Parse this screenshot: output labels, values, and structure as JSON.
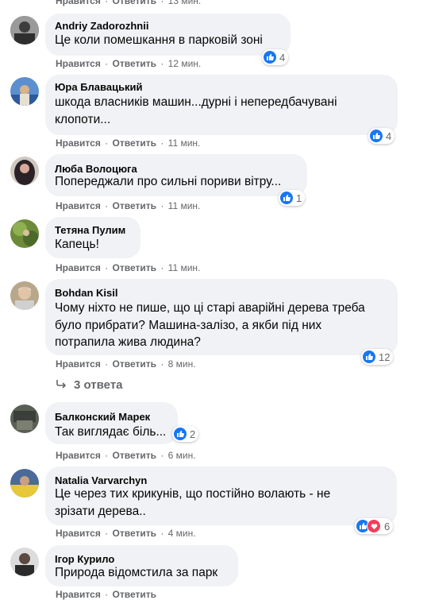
{
  "top_cut": {
    "like": "Нравится",
    "reply": "Ответить",
    "time": "13 мин."
  },
  "comments": [
    {
      "author": "Andriy Zadorozhnii",
      "lines": [
        "Це коли помешкання в парковій зоні"
      ],
      "like": "Нравится",
      "reply": "Ответить",
      "time": "12 мин.",
      "reactions": "4"
    },
    {
      "author": "Юра Блавацький",
      "lines": [
        "шкода власників машин...дурні і непередбачувані",
        "клопоти..."
      ],
      "like": "Нравится",
      "reply": "Ответить",
      "time": "11 мин.",
      "reactions": "4"
    },
    {
      "author": "Люба Волоцюга",
      "lines": [
        "Попереджали про сильні пориви вітру..."
      ],
      "like": "Нравится",
      "reply": "Ответить",
      "time": "11 мин.",
      "reactions": "1"
    },
    {
      "author": "Тетяна Пулим",
      "lines": [
        "Капець!"
      ],
      "like": "Нравится",
      "reply": "Ответить",
      "time": "11 мин.",
      "reactions": ""
    },
    {
      "author": "Bohdan Kisil",
      "lines": [
        "Чому ніхто не пише, що ці старі аварійні дерева треба",
        "було прибрати? Машина-залізо, а якби під них",
        "потрапила жива людина?"
      ],
      "like": "Нравится",
      "reply": "Ответить",
      "time": "8 мин.",
      "reactions": "12"
    },
    {
      "author": "Балконский Марек",
      "lines": [
        "Так виглядає біль..."
      ],
      "like": "Нравится",
      "reply": "Ответить",
      "time": "6 мин.",
      "reactions": "2"
    },
    {
      "author": "Natalia Varvarchyn",
      "lines": [
        "Це через тих крикунів, що постійно волають - не",
        "зрізати дерева.."
      ],
      "like": "Нравится",
      "reply": "Ответить",
      "time": "4 мин.",
      "reactions": "6"
    },
    {
      "author": "Ігор Курило",
      "lines": [
        "Природа відомстила за парк"
      ],
      "like": "Нравится",
      "reply": "Ответить",
      "time": "",
      "reactions": ""
    }
  ],
  "replies_link": "3 ответа",
  "colors": {
    "bubble": "#f0f2f5",
    "like": "#1877f2",
    "love": "#f33e58",
    "muted": "#65676b",
    "text": "#050505"
  }
}
